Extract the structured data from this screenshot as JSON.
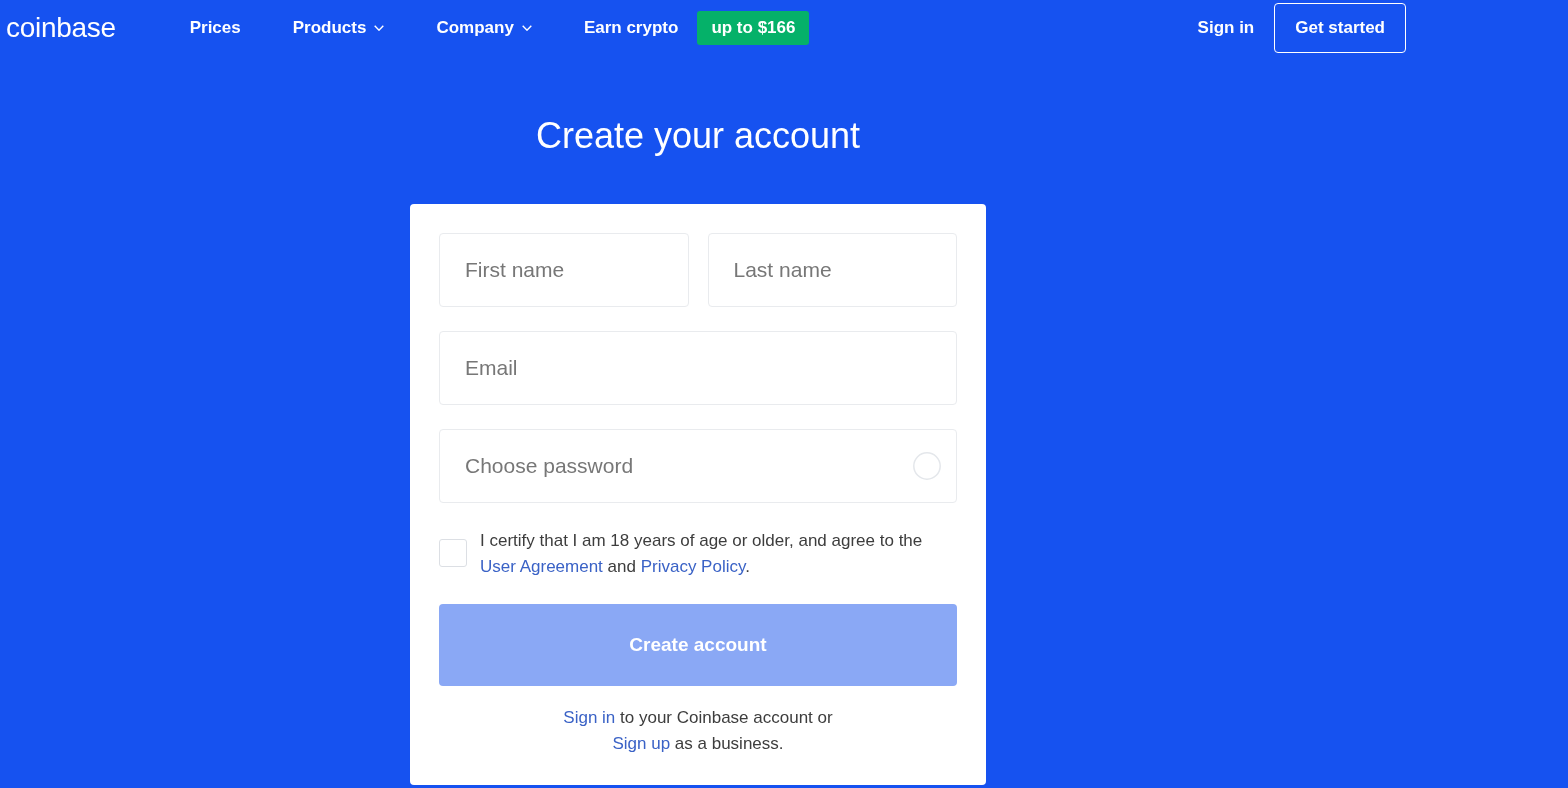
{
  "header": {
    "logo": "coinbase",
    "nav": [
      {
        "label": "Prices",
        "dropdown": false
      },
      {
        "label": "Products",
        "dropdown": true
      },
      {
        "label": "Company",
        "dropdown": true
      },
      {
        "label": "Earn crypto",
        "dropdown": false,
        "badge": "up to $166"
      }
    ],
    "sign_in": "Sign in",
    "get_started": "Get started"
  },
  "title": "Create your account",
  "form": {
    "rows": [
      [
        {
          "kind": "text",
          "placeholder": "First name"
        },
        {
          "kind": "text",
          "placeholder": "Last name"
        }
      ],
      [
        {
          "kind": "text",
          "placeholder": "Email"
        }
      ],
      [
        {
          "kind": "password",
          "placeholder": "Choose password"
        }
      ]
    ],
    "agreement": {
      "checked": false,
      "parts": [
        {
          "kind": "text",
          "text": "I certify that I am 18 years of age or older, and agree to the "
        },
        {
          "kind": "link",
          "text": "User Agreement"
        },
        {
          "kind": "text",
          "text": " and "
        },
        {
          "kind": "link",
          "text": "Privacy Policy"
        },
        {
          "kind": "text",
          "text": "."
        }
      ]
    },
    "submit": {
      "label": "Create account",
      "disabled": true
    },
    "footer": {
      "parts": [
        {
          "kind": "link",
          "text": "Sign in"
        },
        {
          "kind": "text",
          "text": " to your Coinbase account or "
        },
        {
          "kind": "link",
          "text": "Sign up"
        },
        {
          "kind": "text",
          "text": " as a business."
        }
      ]
    }
  }
}
